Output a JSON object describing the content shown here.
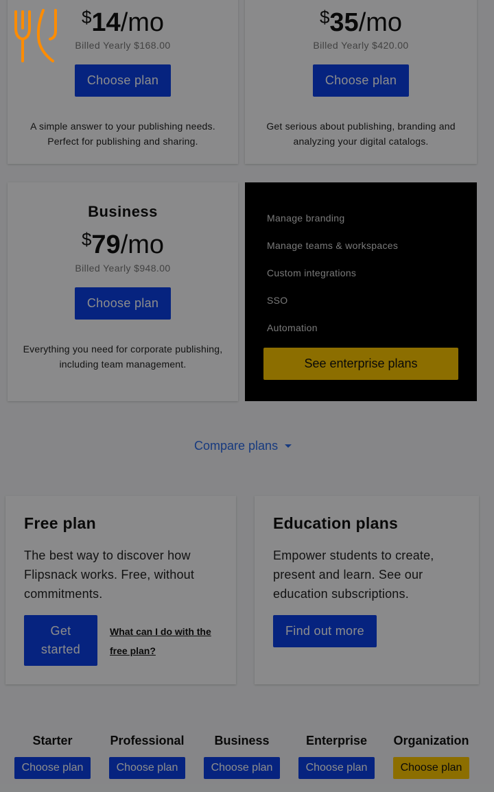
{
  "cards": [
    {
      "currency": "$",
      "amount": "14",
      "period": "/mo",
      "billed": "Billed Yearly $168.00",
      "button": "Choose plan",
      "description": "A simple answer to your publishing needs. Perfect for publishing and sharing."
    },
    {
      "currency": "$",
      "amount": "35",
      "period": "/mo",
      "billed": "Billed Yearly $420.00",
      "button": "Choose plan",
      "description": "Get serious about publishing, branding and analyzing your digital catalogs."
    },
    {
      "title": "Business",
      "currency": "$",
      "amount": "79",
      "period": "/mo",
      "billed": "Billed Yearly $948.00",
      "button": "Choose plan",
      "description": "Everything you need for corporate publishing, including team management."
    }
  ],
  "enterprise": {
    "features": [
      "Manage branding",
      "Manage teams & workspaces",
      "Custom integrations",
      "SSO",
      "Automation"
    ],
    "button": "See enterprise plans"
  },
  "compare_label": "Compare plans",
  "free_plan": {
    "title": "Free plan",
    "text": "The best way to discover how Flipsnack works. Free, without commitments.",
    "button": "Get started",
    "link": "What can I do with the free plan?"
  },
  "education": {
    "title": "Education plans",
    "text": "Empower students to create, present and learn. See our education subscriptions.",
    "button": "Find out more"
  },
  "bottom_plans": [
    {
      "title": "Starter",
      "button": "Choose plan"
    },
    {
      "title": "Professional",
      "button": "Choose plan"
    },
    {
      "title": "Business",
      "button": "Choose plan"
    },
    {
      "title": "Enterprise",
      "button": "Choose plan"
    },
    {
      "title": "Organization",
      "button": "Choose plan"
    }
  ],
  "colors": {
    "primary_button": "#0b40e8",
    "accent_yellow": "#ffc900",
    "logo_orange": "#ff8c00",
    "link_blue": "#2a6ae8"
  },
  "icons": {
    "logo": "fork-knife-logo-icon",
    "dropdown": "caret-down-icon"
  }
}
